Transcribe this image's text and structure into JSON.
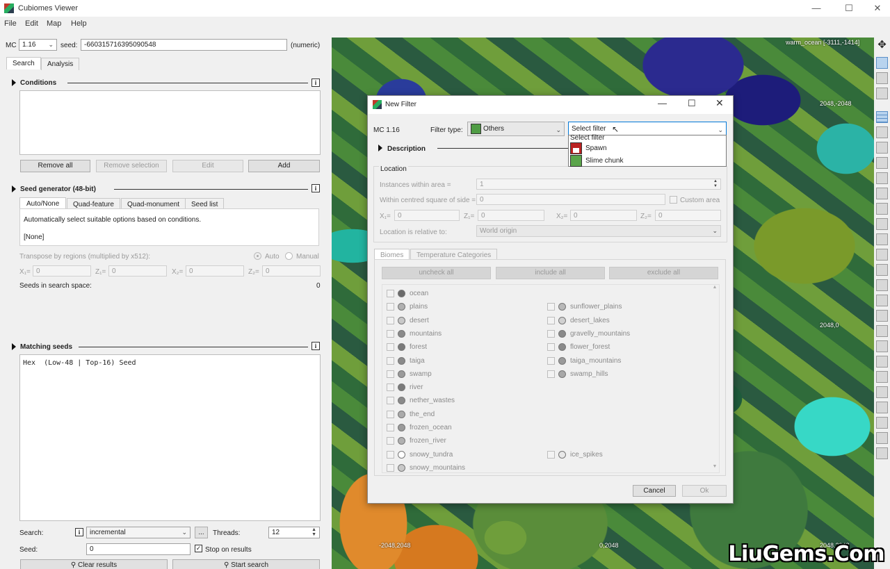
{
  "window": {
    "title": "Cubiomes Viewer",
    "min": "—",
    "max": "☐",
    "close": "✕"
  },
  "menu": [
    "File",
    "Edit",
    "Map",
    "Help"
  ],
  "toolbar": {
    "mc_label": "MC",
    "mc_version": "1.16",
    "seed_label": "seed:",
    "seed_value": "-660315716395090548",
    "seed_type": "(numeric)"
  },
  "tabs": [
    "Search",
    "Analysis"
  ],
  "conditions": {
    "title": "Conditions",
    "buttons": [
      "Remove all",
      "Remove selection",
      "Edit",
      "Add"
    ]
  },
  "seed_generator": {
    "title": "Seed generator (48-bit)",
    "tabs": [
      "Auto/None",
      "Quad-feature",
      "Quad-monument",
      "Seed list"
    ],
    "description": "Automatically select suitable options based on conditions.",
    "mode": "[None]",
    "transpose_label": "Transpose by regions (multiplied by x512):",
    "auto": "Auto",
    "manual": "Manual",
    "x1": "X₁=",
    "z1": "Z₁=",
    "x2": "X₂=",
    "z2": "Z₂=",
    "zero": "0",
    "seeds_space_label": "Seeds in search space:",
    "seeds_space_value": "0"
  },
  "matching": {
    "title": "Matching seeds",
    "header": "Hex  (Low-48 | Top-16) Seed"
  },
  "search": {
    "search_label": "Search:",
    "search_mode": "incremental",
    "ellipsis": "...",
    "threads_label": "Threads:",
    "threads": "12",
    "seed_label": "Seed:",
    "seed_value": "0",
    "stop_label": "Stop on results",
    "clear_label": "Clear results",
    "start_label": "Start search"
  },
  "map": {
    "hover": "warm_ocean [-3111,-1414]",
    "coords": [
      "2048,-2048",
      "2048,0",
      "-2048,2048",
      "0,2048",
      "2048,2048"
    ],
    "colors": {
      "ocean": "#1d1c7a",
      "forest": "#2f6b3a",
      "plains": "#6f9e3b",
      "badlands": "#d6791f",
      "warm_ocean": "#37d8c6"
    }
  },
  "dialog": {
    "title": "New Filter",
    "mc": "MC 1.16",
    "filter_type_label": "Filter type:",
    "filter_type": "Others",
    "filter_select": "Select filter",
    "dropdown": [
      {
        "label": "Select filter",
        "icon": ""
      },
      {
        "label": "Spawn",
        "icon": "house-icon"
      },
      {
        "label": "Slime chunk",
        "icon": "slime-icon"
      }
    ],
    "description": "Description",
    "location": "Location",
    "instances_label": "Instances within area =",
    "instances": "1",
    "square_label": "Within centred square of side =",
    "square": "0",
    "custom_area": "Custom area",
    "x1": "X₁=",
    "z1": "Z₁=",
    "x2": "X₂=",
    "z2": "Z₂=",
    "zero": "0",
    "relative_label": "Location is relative to:",
    "relative": "World origin",
    "tabs": [
      "Biomes",
      "Temperature Categories"
    ],
    "biome_buttons": [
      "uncheck all",
      "include all",
      "exclude all"
    ],
    "biomes_left": [
      {
        "name": "ocean",
        "color": "#6b6b6b"
      },
      {
        "name": "plains",
        "color": "#b0b0b0"
      },
      {
        "name": "desert",
        "color": "#c8c8c8"
      },
      {
        "name": "mountains",
        "color": "#8a8a8a"
      },
      {
        "name": "forest",
        "color": "#7a7a7a"
      },
      {
        "name": "taiga",
        "color": "#8a8a8a"
      },
      {
        "name": "swamp",
        "color": "#9a9a9a"
      },
      {
        "name": "river",
        "color": "#7a7a7a"
      },
      {
        "name": "nether_wastes",
        "color": "#8a8a8a"
      },
      {
        "name": "the_end",
        "color": "#aaaaaa"
      },
      {
        "name": "frozen_ocean",
        "color": "#9a9a9a"
      },
      {
        "name": "frozen_river",
        "color": "#b0b0b0"
      },
      {
        "name": "snowy_tundra",
        "color": "#ffffff"
      },
      {
        "name": "snowy_mountains",
        "color": "#c8c8c8"
      }
    ],
    "biomes_right": [
      {
        "name": "sunflower_plains",
        "color": "#b8b8b8",
        "row": 1
      },
      {
        "name": "desert_lakes",
        "color": "#d0d0d0",
        "row": 2
      },
      {
        "name": "gravelly_mountains",
        "color": "#8a8a8a",
        "row": 3
      },
      {
        "name": "flower_forest",
        "color": "#8a8a8a",
        "row": 4
      },
      {
        "name": "taiga_mountains",
        "color": "#9a9a9a",
        "row": 5
      },
      {
        "name": "swamp_hills",
        "color": "#a8a8a8",
        "row": 6
      },
      {
        "name": "ice_spikes",
        "color": "#e8e8e8",
        "row": 12
      }
    ],
    "cancel": "Cancel",
    "ok": "Ok"
  },
  "watermark": "LiuGems.Com"
}
